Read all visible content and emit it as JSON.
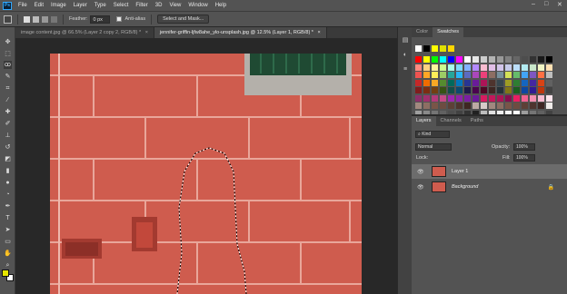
{
  "menubar": {
    "logo": "Ps",
    "items": [
      "File",
      "Edit",
      "Image",
      "Layer",
      "Type",
      "Select",
      "Filter",
      "3D",
      "View",
      "Window",
      "Help"
    ],
    "window_controls": [
      "–",
      "□",
      "✕"
    ]
  },
  "options": {
    "feather_label": "Feather:",
    "feather_value": "0 px",
    "antialias_label": "Anti-alias",
    "select_mask_label": "Select and Mask..."
  },
  "tabs": [
    {
      "label": "image content.jpg @ 66.5% (Layer 2 copy 2, RGB/8) *",
      "close": "×"
    },
    {
      "label": "jennifer-griffin-ljfw8ahe_ylo-unsplash.jpg @ 12.5% (Layer 1, RGB/8) *",
      "close": "×"
    }
  ],
  "swatch_panel": {
    "tabs": [
      "Color",
      "Swatches"
    ]
  },
  "layers_panel": {
    "tabs": [
      "Layers",
      "Channels",
      "Paths"
    ],
    "kind_label": "Kind",
    "blend_mode": "Normal",
    "opacity_label": "Opacity:",
    "opacity_value": "100%",
    "lock_label": "Lock:",
    "fill_label": "Fill:",
    "fill_value": "100%",
    "layers": [
      {
        "name": "Layer 1",
        "selected": true
      },
      {
        "name": "Background",
        "selected": false
      }
    ]
  },
  "colors": {
    "wall": "#cf5c4e",
    "mortar": "#e9a69a",
    "foreground": "#e6e600",
    "background": "#ffffff",
    "shutter": "#1f4a33"
  }
}
